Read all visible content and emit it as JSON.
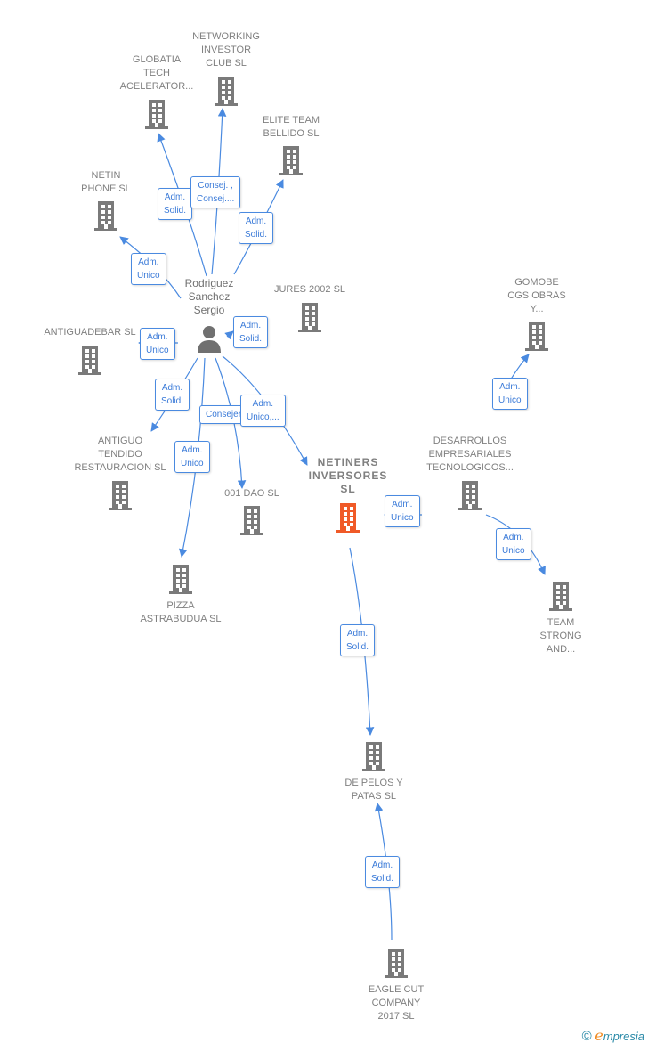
{
  "colors": {
    "company": "#7a7a7a",
    "focus_company": "#f05a28",
    "edge": "#4a8ae0",
    "person": "#707070"
  },
  "nodes": [
    {
      "id": "globatia",
      "label": "GLOBATIA\nTECH\nACELERATOR...",
      "type": "company"
    },
    {
      "id": "networking",
      "label": "NETWORKING\nINVESTOR\nCLUB  SL",
      "type": "company"
    },
    {
      "id": "elite",
      "label": "ELITE TEAM\nBELLIDO  SL",
      "type": "company"
    },
    {
      "id": "netin",
      "label": "NETIN\nPHONE  SL",
      "type": "company"
    },
    {
      "id": "jures",
      "label": "JURES 2002 SL",
      "type": "company"
    },
    {
      "id": "antiguadebar",
      "label": "ANTIGUADEBAR SL",
      "type": "company"
    },
    {
      "id": "gomobe",
      "label": "GOMOBE\nCGS OBRAS\nY...",
      "type": "company"
    },
    {
      "id": "person",
      "label": "Rodriguez\nSanchez\nSergio",
      "type": "person"
    },
    {
      "id": "antiguo",
      "label": "ANTIGUO\nTENDIDO\nRESTAURACION SL",
      "type": "company"
    },
    {
      "id": "dao",
      "label": "001 DAO  SL",
      "type": "company"
    },
    {
      "id": "netiners",
      "label": "NETINERS\nINVERSORES\nSL",
      "type": "focus"
    },
    {
      "id": "desarrollos",
      "label": "DESARROLLOS\nEMPRESARIALES\nTECNOLOGICOS...",
      "type": "company"
    },
    {
      "id": "pizza",
      "label": "PIZZA\nASTRABUDUA SL",
      "type": "company"
    },
    {
      "id": "team",
      "label": "TEAM\nSTRONG\nAND...",
      "type": "company"
    },
    {
      "id": "depelos",
      "label": "DE PELOS Y\nPATAS  SL",
      "type": "company"
    },
    {
      "id": "eagle",
      "label": "EAGLE CUT\nCOMPANY\n2017  SL",
      "type": "company"
    }
  ],
  "edges": [
    {
      "from": "person",
      "to": "globatia",
      "label": "Adm.\nSolid."
    },
    {
      "from": "person",
      "to": "networking",
      "label": "Consej. ,\nConsej...."
    },
    {
      "from": "person",
      "to": "elite",
      "label": "Adm.\nSolid."
    },
    {
      "from": "person",
      "to": "netin",
      "label": "Adm.\nUnico"
    },
    {
      "from": "person",
      "to": "antiguadebar",
      "label": "Adm.\nUnico"
    },
    {
      "from": "person",
      "to": "jures",
      "label": "Adm.\nSolid."
    },
    {
      "from": "person",
      "to": "antiguo",
      "label": "Adm.\nSolid."
    },
    {
      "from": "person",
      "to": "dao",
      "label": "Consejero"
    },
    {
      "from": "person",
      "to": "pizza",
      "label": "Adm.\nUnico"
    },
    {
      "from": "person",
      "to": "netiners",
      "label": "Adm.\nUnico,..."
    },
    {
      "from": "desarrollos",
      "to": "netiners",
      "label": "Adm.\nUnico"
    },
    {
      "from": "desarrollos",
      "to": "gomobe",
      "label": "Adm.\nUnico"
    },
    {
      "from": "desarrollos",
      "to": "team",
      "label": "Adm.\nUnico"
    },
    {
      "from": "netiners",
      "to": "depelos",
      "label": "Adm.\nSolid."
    },
    {
      "from": "eagle",
      "to": "depelos",
      "label": "Adm.\nSolid."
    }
  ],
  "brand": {
    "copyright": "©",
    "name_initial": "e",
    "name_rest": "mpresia"
  }
}
